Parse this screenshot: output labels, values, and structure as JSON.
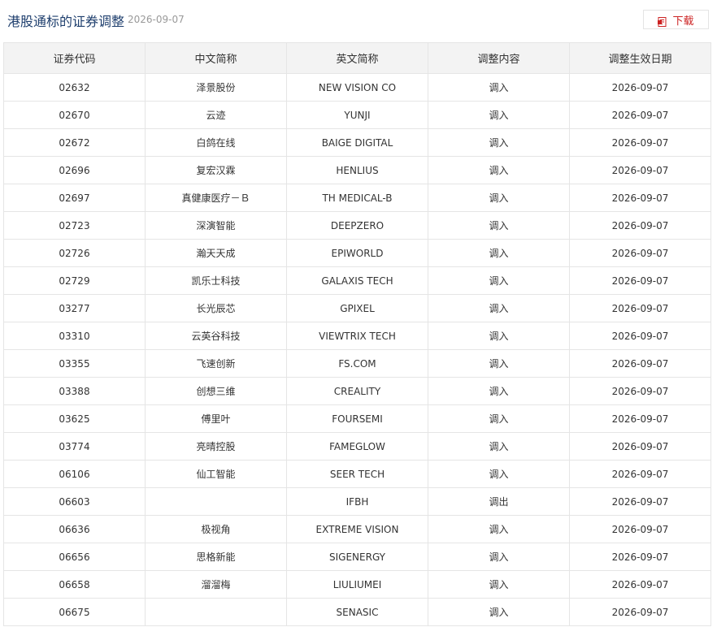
{
  "header": {
    "title": "港股通标的证券调整",
    "date": "2026-09-07",
    "download_label": "下载",
    "download_icon": "download-file-icon"
  },
  "table": {
    "columns": [
      "证券代码",
      "中文简称",
      "英文简称",
      "调整内容",
      "调整生效日期"
    ],
    "rows": [
      [
        "02632",
        "泽景股份",
        "NEW VISION CO",
        "调入",
        "2026-09-07"
      ],
      [
        "02670",
        "云迹",
        "YUNJI",
        "调入",
        "2026-09-07"
      ],
      [
        "02672",
        "白鸽在线",
        "BAIGE DIGITAL",
        "调入",
        "2026-09-07"
      ],
      [
        "02696",
        "复宏汉霖",
        "HENLIUS",
        "调入",
        "2026-09-07"
      ],
      [
        "02697",
        "真健康医疗－Ｂ",
        "TH MEDICAL-B",
        "调入",
        "2026-09-07"
      ],
      [
        "02723",
        "深演智能",
        "DEEPZERO",
        "调入",
        "2026-09-07"
      ],
      [
        "02726",
        "瀚天天成",
        "EPIWORLD",
        "调入",
        "2026-09-07"
      ],
      [
        "02729",
        "凯乐士科技",
        "GALAXIS TECH",
        "调入",
        "2026-09-07"
      ],
      [
        "03277",
        "长光辰芯",
        "GPIXEL",
        "调入",
        "2026-09-07"
      ],
      [
        "03310",
        "云英谷科技",
        "VIEWTRIX TECH",
        "调入",
        "2026-09-07"
      ],
      [
        "03355",
        "飞速创新",
        "FS.COM",
        "调入",
        "2026-09-07"
      ],
      [
        "03388",
        "创想三维",
        "CREALITY",
        "调入",
        "2026-09-07"
      ],
      [
        "03625",
        "傅里叶",
        "FOURSEMI",
        "调入",
        "2026-09-07"
      ],
      [
        "03774",
        "亮晴控股",
        "FAMEGLOW",
        "调入",
        "2026-09-07"
      ],
      [
        "06106",
        "仙工智能",
        "SEER TECH",
        "调入",
        "2026-09-07"
      ],
      [
        "06603",
        "",
        "IFBH",
        "调出",
        "2026-09-07"
      ],
      [
        "06636",
        "极视角",
        "EXTREME VISION",
        "调入",
        "2026-09-07"
      ],
      [
        "06656",
        "思格新能",
        "SIGENERGY",
        "调入",
        "2026-09-07"
      ],
      [
        "06658",
        "溜溜梅",
        "LIULIUMEI",
        "调入",
        "2026-09-07"
      ],
      [
        "06675",
        "",
        "SENASIC",
        "调入",
        "2026-09-07"
      ]
    ]
  },
  "colors": {
    "title": "#1f3f6e",
    "accent": "#cc2222",
    "header_bg": "#f3f3f3",
    "border": "#e5e5e5"
  }
}
